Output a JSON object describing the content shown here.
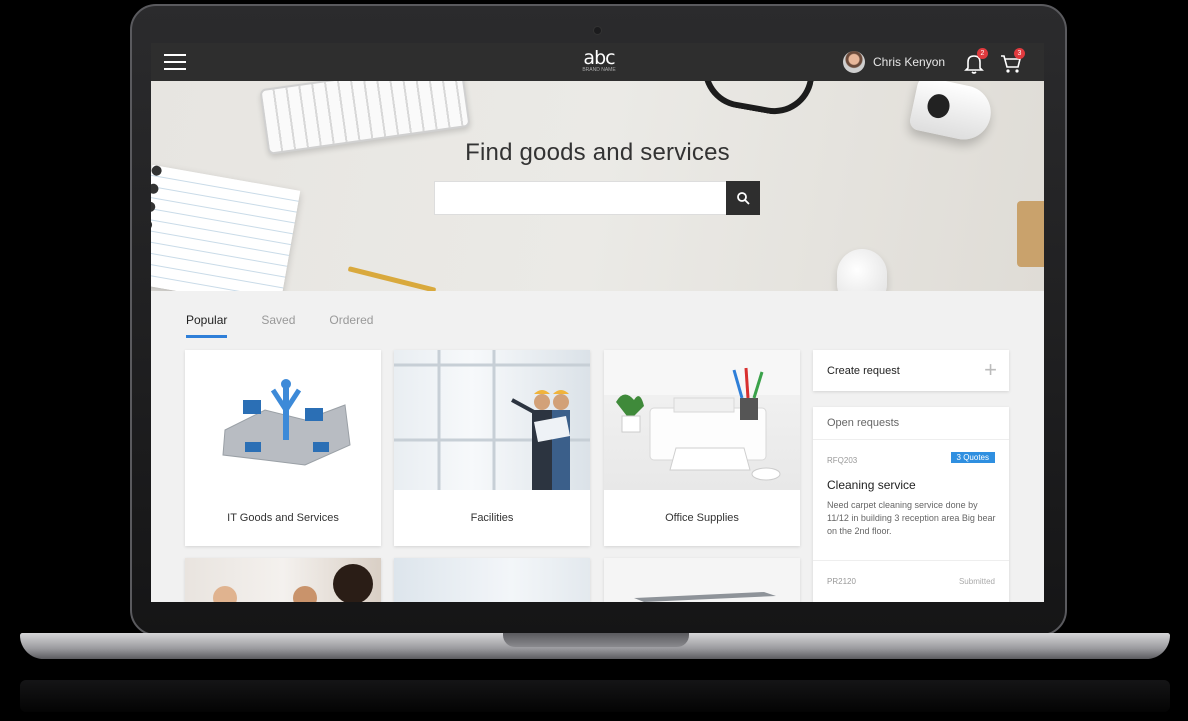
{
  "header": {
    "logo_text": "abc",
    "logo_subtext": "BRAND NAME",
    "user_name": "Chris Kenyon",
    "notifications_count": "2",
    "cart_count": "3"
  },
  "hero": {
    "title": "Find goods and services",
    "search_value": "",
    "search_placeholder": ""
  },
  "tabs": [
    {
      "label": "Popular",
      "active": true
    },
    {
      "label": "Saved",
      "active": false
    },
    {
      "label": "Ordered",
      "active": false
    }
  ],
  "categories": [
    {
      "label": "IT Goods and Services"
    },
    {
      "label": "Facilities"
    },
    {
      "label": "Office Supplies"
    }
  ],
  "sidebar": {
    "create_label": "Create request",
    "open_header": "Open requests",
    "requests": [
      {
        "code": "RFQ203",
        "tag": "3 Quotes",
        "title": "Cleaning service",
        "description": "Need carpet cleaning service done by 11/12 in building 3 reception area Big bear on the 2nd floor."
      },
      {
        "code": "PR2120",
        "tag": "Submitted"
      }
    ]
  },
  "colors": {
    "header_bg": "#2e2e2e",
    "accent_blue": "#2f7fd8",
    "badge_red": "#e03a3e"
  }
}
